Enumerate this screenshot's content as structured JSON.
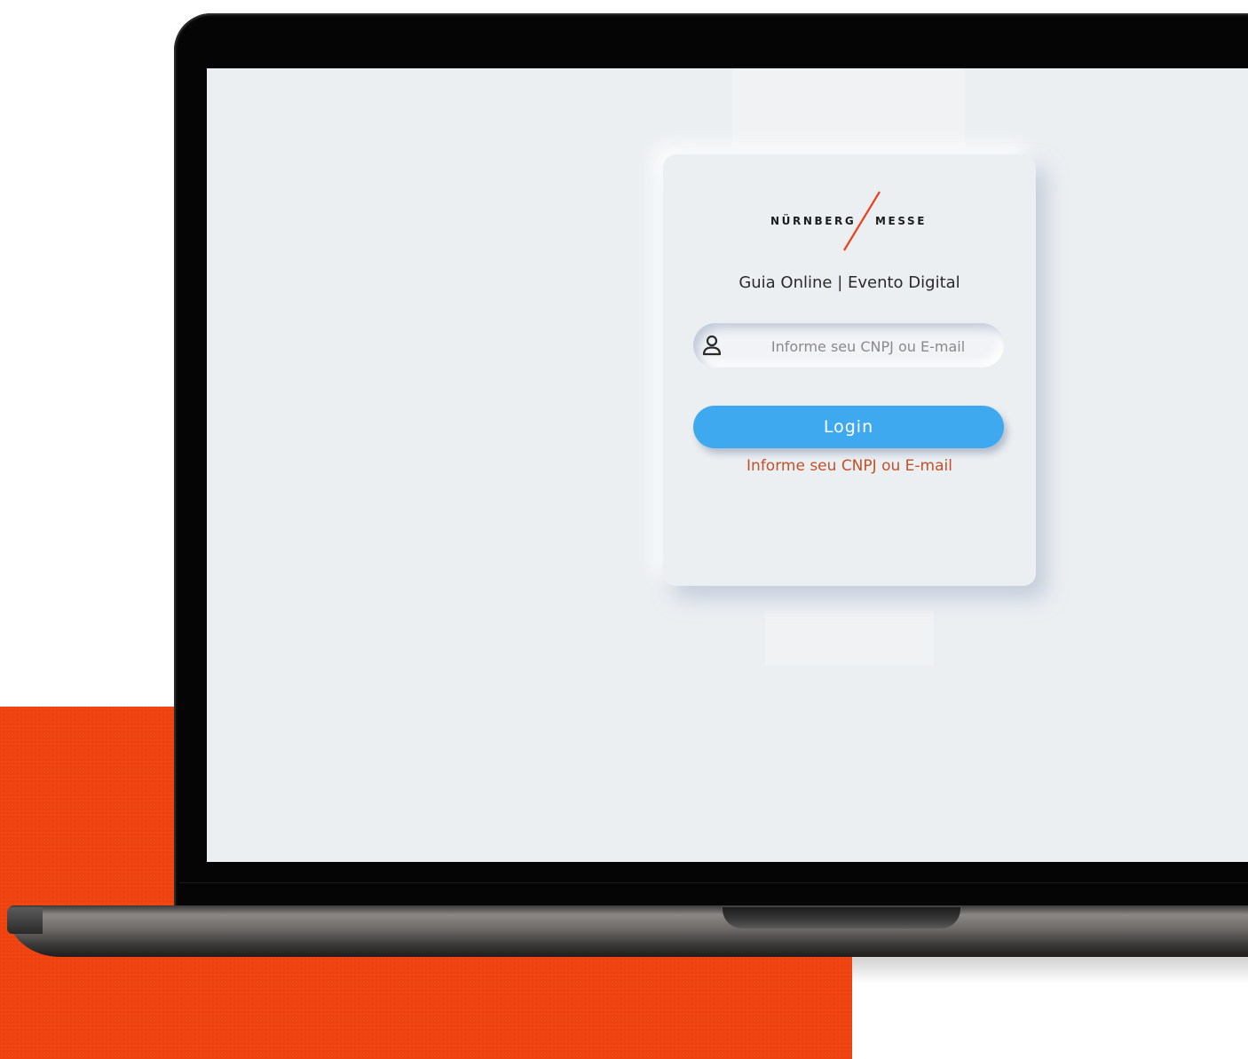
{
  "brand": {
    "logo_left": "NÜRNBERG",
    "logo_right": "MESSE",
    "accent_color": "#e8411c"
  },
  "login": {
    "title": "Guia Online | Evento Digital",
    "input_placeholder": "Informe seu CNPJ ou E-mail",
    "input_value": "",
    "button_label": "Login",
    "error_message": "Informe seu CNPJ ou E-mail",
    "button_color": "#3fa9f0",
    "error_color": "#c2502a"
  },
  "icons": {
    "input_icon": "user-icon"
  },
  "backdrop": {
    "color": "#f0430f"
  }
}
